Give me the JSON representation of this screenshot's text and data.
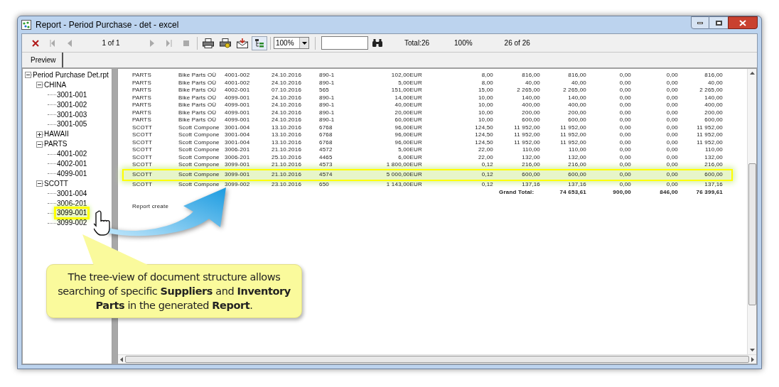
{
  "window": {
    "title": "Report - Period Purchase - det - excel"
  },
  "toolbar": {
    "page": "1 of 1",
    "zoom": "100%",
    "total": "Total:26",
    "percent": "100%",
    "count": "26 of 26",
    "tree_toggle_pressed": true
  },
  "tabs": [
    {
      "label": "Preview",
      "selected": true
    }
  ],
  "tree": [
    {
      "label": "Period Purchase Det.rpt",
      "expanded": true,
      "highlighted": false,
      "children": [
        {
          "label": "CHINA",
          "expanded": true,
          "highlighted": false,
          "children": [
            {
              "label": "3001-001",
              "highlighted": false
            },
            {
              "label": "3001-002",
              "highlighted": false
            },
            {
              "label": "3001-003",
              "highlighted": false
            },
            {
              "label": "3001-005",
              "highlighted": false
            }
          ]
        },
        {
          "label": "HAWAII",
          "expanded": false,
          "highlighted": false
        },
        {
          "label": "PARTS",
          "expanded": true,
          "highlighted": false,
          "children": [
            {
              "label": "4001-002",
              "highlighted": false
            },
            {
              "label": "4002-001",
              "highlighted": false
            },
            {
              "label": "4099-001",
              "highlighted": false
            }
          ]
        },
        {
          "label": "SCOTT",
          "expanded": true,
          "highlighted": false,
          "children": [
            {
              "label": "3001-004",
              "highlighted": false
            },
            {
              "label": "3006-201",
              "highlighted": false
            },
            {
              "label": "3099-001",
              "highlighted": true
            },
            {
              "label": "3099-002",
              "highlighted": false
            }
          ]
        }
      ]
    }
  ],
  "report": {
    "rows": [
      {
        "highlighted": false,
        "cells": [
          "PARTS",
          "Bike Parts OÜ",
          "4001-002",
          "24.10.2016",
          "890-1",
          "102,00EUR",
          "8,00",
          "816,00",
          "816,00",
          "0,00",
          "0,00",
          "816,00"
        ]
      },
      {
        "highlighted": false,
        "cells": [
          "PARTS",
          "Bike Parts OÜ",
          "4001-002",
          "24.10.2016",
          "890-1",
          "5,00EUR",
          "8,00",
          "40,00",
          "40,00",
          "0,00",
          "0,00",
          "40,00"
        ]
      },
      {
        "highlighted": false,
        "cells": [
          "PARTS",
          "Bike Parts OÜ",
          "4002-001",
          "07.10.2016",
          "565",
          "151,00EUR",
          "15,00",
          "2 265,00",
          "2 265,00",
          "0,00",
          "0,00",
          "2 265,00"
        ]
      },
      {
        "highlighted": false,
        "cells": [
          "PARTS",
          "Bike Parts OÜ",
          "4099-001",
          "24.10.2016",
          "890-1",
          "14,00EUR",
          "10,00",
          "140,00",
          "140,00",
          "0,00",
          "0,00",
          "140,00"
        ]
      },
      {
        "highlighted": false,
        "cells": [
          "PARTS",
          "Bike Parts OÜ",
          "4099-001",
          "24.10.2016",
          "890-1",
          "40,00EUR",
          "10,00",
          "400,00",
          "400,00",
          "0,00",
          "0,00",
          "400,00"
        ]
      },
      {
        "highlighted": false,
        "cells": [
          "PARTS",
          "Bike Parts OÜ",
          "4099-001",
          "24.10.2016",
          "890-1",
          "20,00EUR",
          "10,00",
          "200,00",
          "200,00",
          "0,00",
          "0,00",
          "200,00"
        ]
      },
      {
        "highlighted": false,
        "cells": [
          "PARTS",
          "Bike Parts OÜ",
          "4099-001",
          "24.10.2016",
          "890-1",
          "60,00EUR",
          "10,00",
          "600,00",
          "600,00",
          "0,00",
          "0,00",
          "600,00"
        ]
      },
      {
        "highlighted": false,
        "cells": [
          "SCOTT",
          "Scott Compone",
          "3001-004",
          "13.10.2016",
          "6768",
          "96,00EUR",
          "124,50",
          "11 952,00",
          "11 952,00",
          "0,00",
          "0,00",
          "11 952,00"
        ]
      },
      {
        "highlighted": false,
        "cells": [
          "SCOTT",
          "Scott Compone",
          "3001-004",
          "13.10.2016",
          "6768",
          "96,00EUR",
          "124,50",
          "11 952,00",
          "11 952,00",
          "0,00",
          "0,00",
          "11 952,00"
        ]
      },
      {
        "highlighted": false,
        "cells": [
          "SCOTT",
          "Scott Compone",
          "3001-004",
          "13.10.2016",
          "6768",
          "96,00EUR",
          "124,50",
          "11 952,00",
          "11 952,00",
          "0,00",
          "0,00",
          "11 952,00"
        ]
      },
      {
        "highlighted": false,
        "cells": [
          "SCOTT",
          "Scott Compone",
          "3006-201",
          "21.10.2016",
          "4572",
          "5,00EUR",
          "22,00",
          "110,00",
          "110,00",
          "0,00",
          "0,00",
          "110,00"
        ]
      },
      {
        "highlighted": false,
        "cells": [
          "SCOTT",
          "Scott Compone",
          "3006-201",
          "25.10.2016",
          "4465",
          "6,00EUR",
          "22,00",
          "132,00",
          "132,00",
          "0,00",
          "0,00",
          "132,00"
        ]
      },
      {
        "highlighted": false,
        "cells": [
          "SCOTT",
          "Scott Compone",
          "3099-001",
          "21.10.2016",
          "4573",
          "1 800,00EUR",
          "0,12",
          "216,00",
          "216,00",
          "0,00",
          "0,00",
          "216,00"
        ]
      },
      {
        "highlighted": true,
        "cells": [
          "SCOTT",
          "Scott Compone",
          "3099-001",
          "21.10.2016",
          "4574",
          "5 000,00EUR",
          "0,12",
          "600,00",
          "600,00",
          "0,00",
          "0,00",
          "600,00"
        ]
      },
      {
        "highlighted": false,
        "cells": [
          "SCOTT",
          "Scott Compone",
          "3099-002",
          "23.10.2016",
          "650",
          "1 143,00EUR",
          "0,12",
          "137,16",
          "137,16",
          "0,00",
          "0,00",
          "137,16"
        ]
      }
    ],
    "grand_total": {
      "label": "Grand Total:",
      "values": [
        "74 653,61",
        "900,00",
        "846,00",
        "76 399,61"
      ]
    },
    "footer": "Report create"
  },
  "callout": {
    "text": "The tree-view of document structure allows searching of specific **Suppliers** and **Inventory Parts** in the generated **Report**."
  }
}
